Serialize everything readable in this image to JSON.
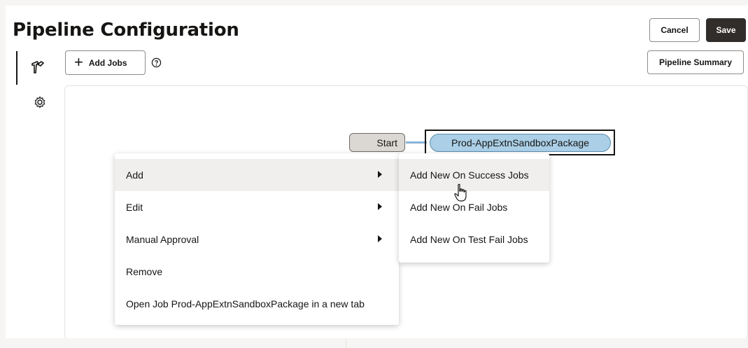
{
  "page": {
    "title": "Pipeline Configuration"
  },
  "header": {
    "cancel_label": "Cancel",
    "save_label": "Save",
    "summary_label": "Pipeline Summary"
  },
  "toolbar": {
    "add_jobs_label": "Add Jobs",
    "add_jobs_icon": "plus-icon",
    "help_icon": "help-circle-icon"
  },
  "sidebar": {
    "items": [
      {
        "icon": "build-hammer-icon",
        "selected": true
      },
      {
        "icon": "gear-icon",
        "selected": false
      }
    ]
  },
  "diagram": {
    "start_label": "Start",
    "job_label": "Prod-AppExtnSandboxPackage",
    "connector_color": "#8ab4d6",
    "job_fill_color": "#aacfe6"
  },
  "context_menu": {
    "items": [
      {
        "label": "Add",
        "has_submenu": true
      },
      {
        "label": "Edit",
        "has_submenu": true
      },
      {
        "label": "Manual Approval",
        "has_submenu": true
      },
      {
        "label": "Remove",
        "has_submenu": false
      },
      {
        "label": "Open Job Prod-AppExtnSandboxPackage in a new tab",
        "has_submenu": false
      }
    ]
  },
  "submenu": {
    "items": [
      {
        "label": "Add New On Success Jobs"
      },
      {
        "label": "Add New On Fail Jobs"
      },
      {
        "label": "Add New On Test Fail Jobs"
      }
    ]
  }
}
